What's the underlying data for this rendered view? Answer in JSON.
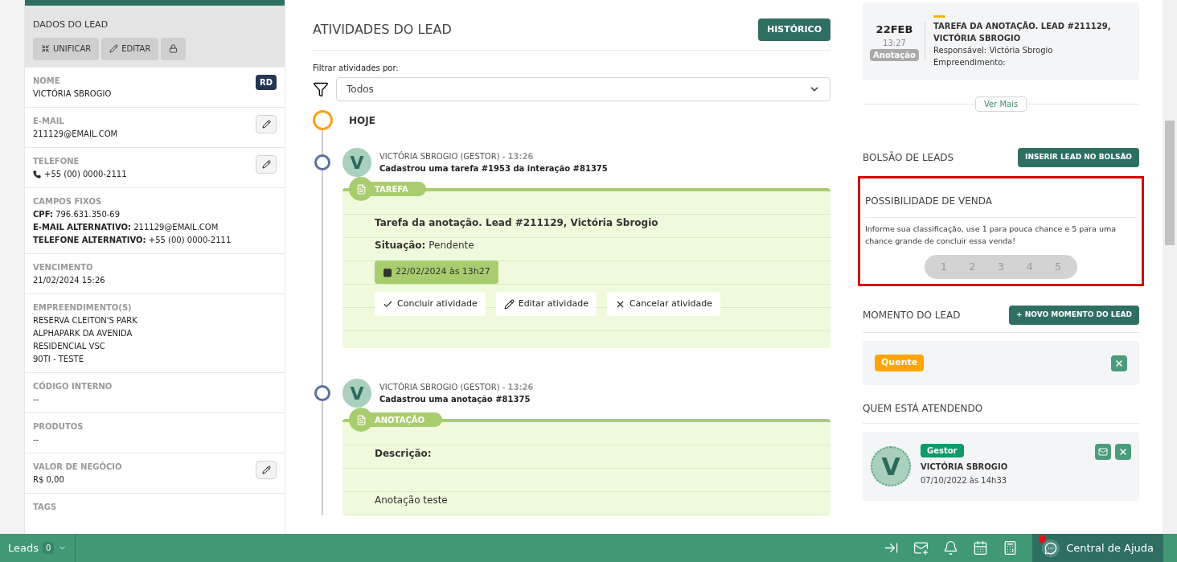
{
  "lead_panel": {
    "title": "DADOS DO LEAD",
    "actions": [
      {
        "kind": "merge",
        "label": "UNIFICAR"
      },
      {
        "kind": "edit",
        "label": "EDITAR"
      },
      {
        "kind": "lock"
      }
    ],
    "fields": [
      {
        "label": "NOME",
        "kind": "text",
        "values": [
          "VICTÓRIA SBROGIO"
        ],
        "badge": "RD",
        "editable": false
      },
      {
        "label": "E-MAIL",
        "kind": "text",
        "values": [
          "211129@EMAIL.COM"
        ],
        "editable": true
      },
      {
        "label": "TELEFONE",
        "kind": "phone",
        "values": [
          "+55 (00) 0000-2111"
        ],
        "editable": true
      },
      {
        "label": "CAMPOS FIXOS",
        "kind": "text",
        "values": [
          "**CPF:** 796.631.350-69",
          "**E-MAIL ALTERNATIVO:** 211129@EMAIL.COM",
          "**TELEFONE ALTERNATIVO:** +55 (00) 0000-2111"
        ],
        "editable": false
      },
      {
        "label": "VENCIMENTO",
        "kind": "text",
        "values": [
          "21/02/2024 15:26"
        ],
        "editable": false
      },
      {
        "label": "EMPREENDIMENTO(S)",
        "kind": "text",
        "values": [
          "RESERVA CLEITON'S PARK",
          "ALPHAPARK DA AVENIDA",
          "RESIDENCIAL VSC",
          "90TI - TESTE"
        ],
        "editable": false
      },
      {
        "label": "CÓDIGO INTERNO",
        "kind": "text",
        "values": [
          "--"
        ],
        "editable": false
      },
      {
        "label": "PRODUTOS",
        "kind": "text",
        "values": [
          "--"
        ],
        "editable": false
      },
      {
        "label": "VALOR DE NEGÓCIO",
        "kind": "text",
        "values": [
          "R$ 0,00"
        ],
        "editable": true
      },
      {
        "label": "TAGS",
        "editable": false
      }
    ]
  },
  "activities": {
    "title": "ATIVIDADES DO LEAD",
    "history_button": "HISTÓRICO",
    "filter_label": "Filtrar atividades por:",
    "filter_value": "Todos",
    "day": "HOJE",
    "entries": [
      {
        "avatar": "V",
        "author": "VICTÓRIA SBROGIO (GESTOR) -",
        "time": "13:26",
        "summary": "Cadastrou uma tarefa #1953 da interação #81375",
        "card": {
          "kind": "task",
          "tag": "TAREFA",
          "title": "Tarefa da anotação. Lead #211129, Victória Sbrogio",
          "status_label": "Situação:",
          "status": "Pendente",
          "due": "22/02/2024 às 13h27",
          "buttons": [
            {
              "kind": "check",
              "label": "Concluir atividade"
            },
            {
              "kind": "edit",
              "label": "Editar atividade"
            },
            {
              "kind": "cancel",
              "label": "Cancelar atividade"
            }
          ]
        }
      },
      {
        "avatar": "V",
        "author": "VICTÓRIA SBROGIO (GESTOR) -",
        "time": "13:26",
        "summary": "Cadastrou uma anotação #81375",
        "card": {
          "kind": "note",
          "tag": "ANOTAÇÃO",
          "title": "Descrição:",
          "body": "Anotação teste"
        }
      }
    ]
  },
  "side": {
    "next_task": {
      "day": "22FEB",
      "time": "13:27",
      "type": "Anotação",
      "title": "TAREFA DA ANOTAÇÃO. LEAD #211129, VICTÓRIA SBROGIO",
      "responsible": "Responsável: Victória Sbrogio",
      "project": "Empreendimento:"
    },
    "more_button": "Ver Mais",
    "pool": {
      "title": "BOLSÃO DE LEADS",
      "button": "INSERIR LEAD NO BOLSÃO"
    },
    "sale_chance": {
      "title": "POSSIBILIDADE DE VENDA",
      "highlighted": true,
      "hint": "Informe sua classificação, use 1 para pouca chance e 5 para uma chance grande de concluir essa venda!",
      "options": [
        {
          "label": "1",
          "selected": false
        },
        {
          "label": "2",
          "selected": false
        },
        {
          "label": "3",
          "selected": false
        },
        {
          "label": "4",
          "selected": false
        },
        {
          "label": "5",
          "selected": false
        }
      ]
    },
    "moment": {
      "title": "MOMENTO DO LEAD",
      "button": "+ NOVO MOMENTO DO LEAD",
      "tag": "Quente",
      "color": "#ffa500"
    },
    "attending": {
      "title": "QUEM ESTÁ ATENDENDO",
      "people": [
        {
          "avatar": "V",
          "role": "Gestor",
          "name": "VICTÓRIA SBROGIO",
          "since": "07/10/2022 às 14h33"
        }
      ]
    }
  },
  "bottom_bar": {
    "leads_label": "Leads",
    "leads_count": "0",
    "help": "Central de Ajuda",
    "help_alert": true
  }
}
